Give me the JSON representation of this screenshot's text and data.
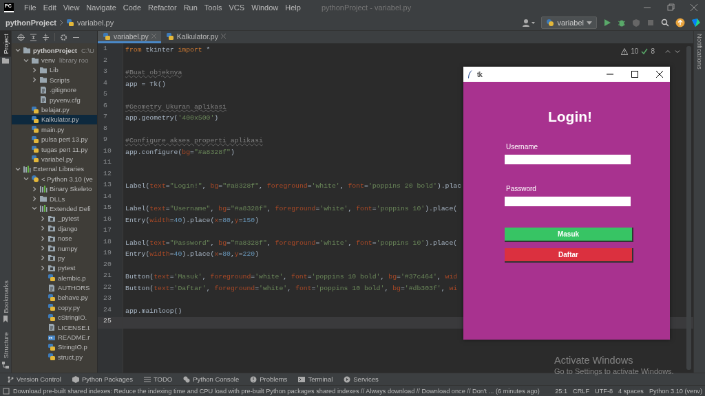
{
  "app_logo": "PC",
  "menu": [
    "File",
    "Edit",
    "View",
    "Navigate",
    "Code",
    "Refactor",
    "Run",
    "Tools",
    "VCS",
    "Window",
    "Help"
  ],
  "window_title": "pythonProject - variabel.py",
  "breadcrumb": [
    "pythonProject",
    "variabel.py"
  ],
  "run_config": "variabel",
  "side_tabs": [
    {
      "label": "Project",
      "selected": true
    },
    {
      "label": "Bookmarks",
      "selected": false
    },
    {
      "label": "Structure",
      "selected": false
    }
  ],
  "right_tabs": [
    "Notifications"
  ],
  "project_tree": [
    {
      "kind": "project-folder",
      "label": "pythonProject",
      "hint": "C:\\U",
      "selected": false,
      "expanded": true,
      "children": [
        {
          "kind": "folder",
          "label": "venv",
          "hint": "library roo",
          "selected": false,
          "expanded": true,
          "children": [
            {
              "kind": "folder",
              "label": "Lib",
              "selected": false,
              "expanded": false
            },
            {
              "kind": "folder",
              "label": "Scripts",
              "selected": false,
              "expanded": false
            },
            {
              "kind": "text-file",
              "label": ".gitignore",
              "selected": false
            },
            {
              "kind": "text-file",
              "label": "pyvenv.cfg",
              "selected": false
            }
          ]
        },
        {
          "kind": "python-file",
          "label": "belajar.py",
          "selected": false
        },
        {
          "kind": "python-file",
          "label": "Kalkulator.py",
          "selected": true
        },
        {
          "kind": "python-file",
          "label": "main.py",
          "selected": false
        },
        {
          "kind": "python-file",
          "label": "pulsa pert 13.py",
          "selected": false
        },
        {
          "kind": "python-file",
          "label": "tugas pert 11.py",
          "selected": false
        },
        {
          "kind": "python-file",
          "label": "variabel.py",
          "selected": false
        }
      ]
    },
    {
      "kind": "library",
      "label": "External Libraries",
      "selected": false,
      "expanded": true,
      "children": [
        {
          "kind": "interpreter",
          "label": "< Python 3.10 (ve",
          "selected": false,
          "expanded": true,
          "children": [
            {
              "kind": "library",
              "label": "Binary Skeleto",
              "selected": false,
              "expanded": false
            },
            {
              "kind": "folder",
              "label": "DLLs",
              "selected": false,
              "expanded": false
            },
            {
              "kind": "library",
              "label": "Extended Defi",
              "selected": false,
              "expanded": true,
              "children": [
                {
                  "kind": "package",
                  "label": "_pytest",
                  "selected": false,
                  "expanded": false
                },
                {
                  "kind": "package",
                  "label": "django",
                  "selected": false,
                  "expanded": false
                },
                {
                  "kind": "package",
                  "label": "nose",
                  "selected": false,
                  "expanded": false
                },
                {
                  "kind": "package",
                  "label": "numpy",
                  "selected": false,
                  "expanded": false
                },
                {
                  "kind": "package",
                  "label": "py",
                  "selected": false,
                  "expanded": false
                },
                {
                  "kind": "package",
                  "label": "pytest",
                  "selected": false,
                  "expanded": false
                },
                {
                  "kind": "python-file",
                  "label": "alembic.p",
                  "selected": false
                },
                {
                  "kind": "text-file",
                  "label": "AUTHORS",
                  "selected": false
                },
                {
                  "kind": "python-file",
                  "label": "behave.py",
                  "selected": false
                },
                {
                  "kind": "python-file",
                  "label": "copy.py",
                  "selected": false
                },
                {
                  "kind": "python-file",
                  "label": "cStringIO.",
                  "selected": false
                },
                {
                  "kind": "text-file",
                  "label": "LICENSE.t",
                  "selected": false
                },
                {
                  "kind": "markdown-file",
                  "label": "README.r",
                  "selected": false
                },
                {
                  "kind": "python-file",
                  "label": "StringIO.p",
                  "selected": false
                },
                {
                  "kind": "python-file",
                  "label": "struct.py",
                  "selected": false
                }
              ]
            }
          ]
        }
      ]
    }
  ],
  "editor_tabs": [
    {
      "label": "variabel.py",
      "selected": true
    },
    {
      "label": "Kalkulator.py",
      "selected": false
    }
  ],
  "inspections": {
    "warnings": "10",
    "passed": "8"
  },
  "code_lines": [
    {
      "number": "1",
      "current": false,
      "tokens": [
        {
          "kind": "keyword",
          "text": "from"
        },
        {
          "kind": "plain",
          "text": " tkinter "
        },
        {
          "kind": "keyword",
          "text": "import"
        },
        {
          "kind": "plain",
          "text": " *"
        }
      ]
    },
    {
      "number": "2",
      "current": false
    },
    {
      "number": "3",
      "current": false,
      "tokens": [
        {
          "kind": "comment",
          "text": "#Buat objeknya"
        }
      ]
    },
    {
      "number": "4",
      "current": false,
      "tokens": [
        {
          "kind": "plain",
          "text": "app = Tk()"
        }
      ]
    },
    {
      "number": "5",
      "current": false
    },
    {
      "number": "6",
      "current": false,
      "tokens": [
        {
          "kind": "comment",
          "text": "#Geometry Ukuran aplikasi"
        }
      ]
    },
    {
      "number": "7",
      "current": false,
      "tokens": [
        {
          "kind": "plain",
          "text": "app.geometry("
        },
        {
          "kind": "string",
          "text": "'400x500'"
        },
        {
          "kind": "plain",
          "text": ")"
        }
      ]
    },
    {
      "number": "8",
      "current": false
    },
    {
      "number": "9",
      "current": false,
      "tokens": [
        {
          "kind": "comment",
          "text": "#Configure akses properti aplikasi"
        }
      ]
    },
    {
      "number": "10",
      "current": false,
      "tokens": [
        {
          "kind": "plain",
          "text": "app.configure("
        },
        {
          "kind": "arg",
          "text": "bg"
        },
        {
          "kind": "plain",
          "text": "="
        },
        {
          "kind": "string",
          "text": "\"#a8328f\""
        },
        {
          "kind": "plain",
          "text": ")"
        }
      ]
    },
    {
      "number": "11",
      "current": false
    },
    {
      "number": "12",
      "current": false
    },
    {
      "number": "13",
      "current": false,
      "tokens": [
        {
          "kind": "plain",
          "text": "Label("
        },
        {
          "kind": "arg",
          "text": "text"
        },
        {
          "kind": "plain",
          "text": "="
        },
        {
          "kind": "string",
          "text": "\"Login!\""
        },
        {
          "kind": "plain",
          "text": ", "
        },
        {
          "kind": "arg",
          "text": "bg"
        },
        {
          "kind": "plain",
          "text": "="
        },
        {
          "kind": "string",
          "text": "\"#a8328f\""
        },
        {
          "kind": "plain",
          "text": ", "
        },
        {
          "kind": "arg",
          "text": "foreground"
        },
        {
          "kind": "plain",
          "text": "="
        },
        {
          "kind": "string",
          "text": "'white'"
        },
        {
          "kind": "plain",
          "text": ", "
        },
        {
          "kind": "arg",
          "text": "font"
        },
        {
          "kind": "plain",
          "text": "="
        },
        {
          "kind": "string",
          "text": "'poppins 20 bold'"
        },
        {
          "kind": "plain",
          "text": ").plac"
        }
      ]
    },
    {
      "number": "14",
      "current": false
    },
    {
      "number": "15",
      "current": false,
      "tokens": [
        {
          "kind": "plain",
          "text": "Label("
        },
        {
          "kind": "arg",
          "text": "text"
        },
        {
          "kind": "plain",
          "text": "="
        },
        {
          "kind": "string",
          "text": "\"Username\""
        },
        {
          "kind": "plain",
          "text": ", "
        },
        {
          "kind": "arg",
          "text": "bg"
        },
        {
          "kind": "plain",
          "text": "="
        },
        {
          "kind": "string",
          "text": "\"#a8328f\""
        },
        {
          "kind": "plain",
          "text": ", "
        },
        {
          "kind": "arg",
          "text": "foreground"
        },
        {
          "kind": "plain",
          "text": "="
        },
        {
          "kind": "string",
          "text": "'white'"
        },
        {
          "kind": "plain",
          "text": ", "
        },
        {
          "kind": "arg",
          "text": "font"
        },
        {
          "kind": "plain",
          "text": "="
        },
        {
          "kind": "string",
          "text": "'poppins 10'"
        },
        {
          "kind": "plain",
          "text": ").place("
        }
      ]
    },
    {
      "number": "16",
      "current": false,
      "tokens": [
        {
          "kind": "plain",
          "text": "Entry("
        },
        {
          "kind": "arg",
          "text": "width"
        },
        {
          "kind": "plain",
          "text": "="
        },
        {
          "kind": "number",
          "text": "40"
        },
        {
          "kind": "plain",
          "text": ").place("
        },
        {
          "kind": "arg",
          "text": "x"
        },
        {
          "kind": "plain",
          "text": "="
        },
        {
          "kind": "number",
          "text": "80"
        },
        {
          "kind": "plain",
          "text": ","
        },
        {
          "kind": "arg",
          "text": "y"
        },
        {
          "kind": "plain",
          "text": "="
        },
        {
          "kind": "number",
          "text": "150"
        },
        {
          "kind": "plain",
          "text": ")"
        }
      ]
    },
    {
      "number": "17",
      "current": false
    },
    {
      "number": "18",
      "current": false,
      "tokens": [
        {
          "kind": "plain",
          "text": "Label("
        },
        {
          "kind": "arg",
          "text": "text"
        },
        {
          "kind": "plain",
          "text": "="
        },
        {
          "kind": "string",
          "text": "\"Password\""
        },
        {
          "kind": "plain",
          "text": ", "
        },
        {
          "kind": "arg",
          "text": "bg"
        },
        {
          "kind": "plain",
          "text": "="
        },
        {
          "kind": "string",
          "text": "\"#a8328f\""
        },
        {
          "kind": "plain",
          "text": ", "
        },
        {
          "kind": "arg",
          "text": "foreground"
        },
        {
          "kind": "plain",
          "text": "="
        },
        {
          "kind": "string",
          "text": "'white'"
        },
        {
          "kind": "plain",
          "text": ", "
        },
        {
          "kind": "arg",
          "text": "font"
        },
        {
          "kind": "plain",
          "text": "="
        },
        {
          "kind": "string",
          "text": "'poppins 10'"
        },
        {
          "kind": "plain",
          "text": ").place("
        }
      ]
    },
    {
      "number": "19",
      "current": false,
      "tokens": [
        {
          "kind": "plain",
          "text": "Entry("
        },
        {
          "kind": "arg",
          "text": "width"
        },
        {
          "kind": "plain",
          "text": "="
        },
        {
          "kind": "number",
          "text": "40"
        },
        {
          "kind": "plain",
          "text": ").place("
        },
        {
          "kind": "arg",
          "text": "x"
        },
        {
          "kind": "plain",
          "text": "="
        },
        {
          "kind": "number",
          "text": "80"
        },
        {
          "kind": "plain",
          "text": ","
        },
        {
          "kind": "arg",
          "text": "y"
        },
        {
          "kind": "plain",
          "text": "="
        },
        {
          "kind": "number",
          "text": "220"
        },
        {
          "kind": "plain",
          "text": ")"
        }
      ]
    },
    {
      "number": "20",
      "current": false
    },
    {
      "number": "21",
      "current": false,
      "tokens": [
        {
          "kind": "plain",
          "text": "Button("
        },
        {
          "kind": "arg",
          "text": "text"
        },
        {
          "kind": "plain",
          "text": "="
        },
        {
          "kind": "string",
          "text": "'Masuk'"
        },
        {
          "kind": "plain",
          "text": ", "
        },
        {
          "kind": "arg",
          "text": "foreground"
        },
        {
          "kind": "plain",
          "text": "="
        },
        {
          "kind": "string",
          "text": "'white'"
        },
        {
          "kind": "plain",
          "text": ", "
        },
        {
          "kind": "arg",
          "text": "font"
        },
        {
          "kind": "plain",
          "text": "="
        },
        {
          "kind": "string",
          "text": "'poppins 10 bold'"
        },
        {
          "kind": "plain",
          "text": ", "
        },
        {
          "kind": "arg",
          "text": "bg"
        },
        {
          "kind": "plain",
          "text": "="
        },
        {
          "kind": "string",
          "text": "'#37c464'"
        },
        {
          "kind": "plain",
          "text": ", "
        },
        {
          "kind": "arg",
          "text": "wid"
        }
      ]
    },
    {
      "number": "22",
      "current": false,
      "tokens": [
        {
          "kind": "plain",
          "text": "Button("
        },
        {
          "kind": "arg",
          "text": "text"
        },
        {
          "kind": "plain",
          "text": "="
        },
        {
          "kind": "string",
          "text": "'Daftar'"
        },
        {
          "kind": "plain",
          "text": ", "
        },
        {
          "kind": "arg",
          "text": "foreground"
        },
        {
          "kind": "plain",
          "text": "="
        },
        {
          "kind": "string",
          "text": "'white'"
        },
        {
          "kind": "plain",
          "text": ", "
        },
        {
          "kind": "arg",
          "text": "font"
        },
        {
          "kind": "plain",
          "text": "="
        },
        {
          "kind": "string",
          "text": "'poppins 10 bold'"
        },
        {
          "kind": "plain",
          "text": ", "
        },
        {
          "kind": "arg",
          "text": "bg"
        },
        {
          "kind": "plain",
          "text": "="
        },
        {
          "kind": "string",
          "text": "'#db303f'"
        },
        {
          "kind": "plain",
          "text": ", "
        },
        {
          "kind": "arg",
          "text": "wi"
        }
      ]
    },
    {
      "number": "23",
      "current": false
    },
    {
      "number": "24",
      "current": false,
      "tokens": [
        {
          "kind": "plain",
          "text": "app.mainloop()"
        }
      ]
    },
    {
      "number": "25",
      "current": true
    }
  ],
  "tool_windows": [
    "Version Control",
    "Python Packages",
    "TODO",
    "Python Console",
    "Problems",
    "Terminal",
    "Services"
  ],
  "status": {
    "message": "Download pre-built shared indexes: Reduce the indexing time and CPU load with pre-built Python packages shared indexes // Always download // Download once // Don't ... (6 minutes ago)",
    "position": "25:1",
    "line_separator": "CRLF",
    "encoding": "UTF-8",
    "indent": "4 spaces",
    "interpreter": "Python 3.10 (venv)"
  },
  "tk_window": {
    "title": "tk",
    "heading": "Login!",
    "fields": [
      {
        "label": "Username"
      },
      {
        "label": "Password"
      }
    ],
    "buttons": [
      {
        "label": "Masuk",
        "color": "#37c464"
      },
      {
        "label": "Daftar",
        "color": "#db303f"
      }
    ]
  },
  "os_notice": {
    "title": "Activate Windows",
    "subtitle": "Go to Settings to activate Windows."
  }
}
